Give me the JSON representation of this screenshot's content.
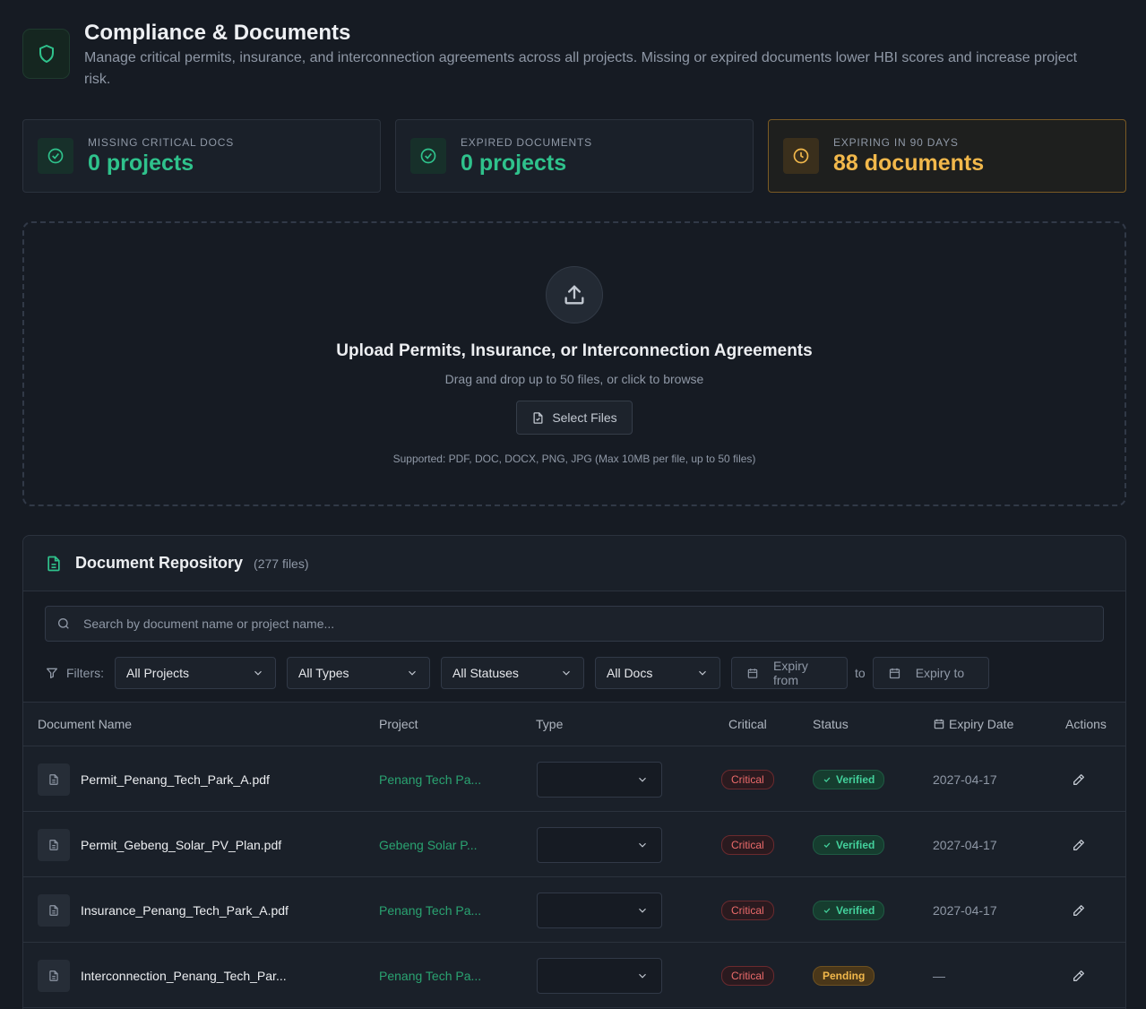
{
  "header": {
    "title": "Compliance & Documents",
    "description": "Manage critical permits, insurance, and interconnection agreements across all projects. Missing or expired documents lower HBI scores and increase project risk."
  },
  "stats": [
    {
      "label": "MISSING CRITICAL DOCS",
      "value": "0 projects",
      "icon": "check-circle-icon"
    },
    {
      "label": "EXPIRED DOCUMENTS",
      "value": "0 projects",
      "icon": "check-circle-icon"
    },
    {
      "label": "EXPIRING IN 90 DAYS",
      "value": "88 documents",
      "icon": "clock-icon"
    }
  ],
  "upload": {
    "title": "Upload Permits, Insurance, or Interconnection Agreements",
    "subtitle": "Drag and drop up to 50 files, or click to browse",
    "button": "Select Files",
    "note": "Supported: PDF, DOC, DOCX, PNG, JPG (Max 10MB per file, up to 50 files)"
  },
  "repository": {
    "title": "Document Repository",
    "count": "(277 files)",
    "search_placeholder": "Search by document name or project name...",
    "filters_label": "Filters:",
    "filters": {
      "project": "All Projects",
      "type": "All Types",
      "status": "All Statuses",
      "docs": "All Docs",
      "expiry_from": "Expiry from",
      "to": "to",
      "expiry_to": "Expiry to"
    },
    "columns": [
      "Document Name",
      "Project",
      "Type",
      "Critical",
      "Status",
      "Expiry Date",
      "Actions"
    ],
    "rows": [
      {
        "name": "Permit_Penang_Tech_Park_A.pdf",
        "project": "Penang Tech Pa...",
        "critical": "Critical",
        "status": "Verified",
        "expiry": "2027-04-17"
      },
      {
        "name": "Permit_Gebeng_Solar_PV_Plan.pdf",
        "project": "Gebeng Solar P...",
        "critical": "Critical",
        "status": "Verified",
        "expiry": "2027-04-17"
      },
      {
        "name": "Insurance_Penang_Tech_Park_A.pdf",
        "project": "Penang Tech Pa...",
        "critical": "Critical",
        "status": "Verified",
        "expiry": "2027-04-17"
      },
      {
        "name": "Interconnection_Penang_Tech_Par...",
        "project": "Penang Tech Pa...",
        "critical": "Critical",
        "status": "Pending",
        "expiry": "—"
      }
    ]
  },
  "colors": {
    "accent": "#2fc28c",
    "warning": "#f2b84b",
    "danger": "#ec6b6b",
    "background": "#161b23"
  }
}
